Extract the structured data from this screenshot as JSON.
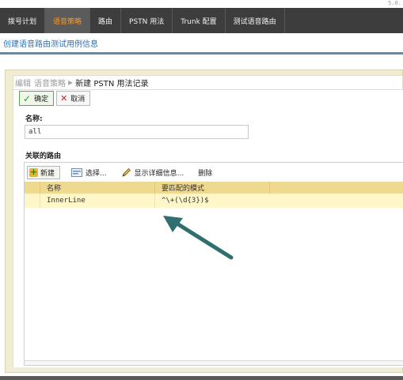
{
  "version": "5.0.",
  "nav": {
    "tabs": [
      {
        "label": "拨号计划"
      },
      {
        "label": "语音策略"
      },
      {
        "label": "路由"
      },
      {
        "label": "PSTN 用法"
      },
      {
        "label": "Trunk 配置"
      },
      {
        "label": "测试语音路由"
      }
    ],
    "active_index": 1
  },
  "subheader": {
    "title": "创建语音路由测试用例信息"
  },
  "breadcrumb": {
    "part1": "编辑",
    "part2": "语音策略",
    "current": "新建 PSTN 用法记录"
  },
  "actions": {
    "ok_label": "确定",
    "cancel_label": "取消"
  },
  "form": {
    "name_label": "名称:",
    "name_value": "all"
  },
  "routes": {
    "label": "关联的路由",
    "toolbar": {
      "new_label": "新建",
      "select_label": "选择...",
      "details_label": "显示详细信息...",
      "delete_label": "删除"
    },
    "columns": [
      "名称",
      "要匹配的模式"
    ],
    "rows": [
      {
        "name": "InnerLine",
        "pattern": "^\\+(\\d{3})$"
      }
    ]
  },
  "colors": {
    "nav_bg": "#3d3d3d",
    "active_tab_text": "#ff9a1f",
    "link": "#2a6fb0",
    "panel_bg": "#f1ecd4",
    "grid_header": "#efd88f",
    "selected_row": "#fff6c9",
    "arrow": "#2f6f6f"
  },
  "icons": [
    "check-icon",
    "cancel-x-icon",
    "plus-icon",
    "select-list-icon",
    "pencil-icon",
    "annotation-arrow-icon"
  ]
}
